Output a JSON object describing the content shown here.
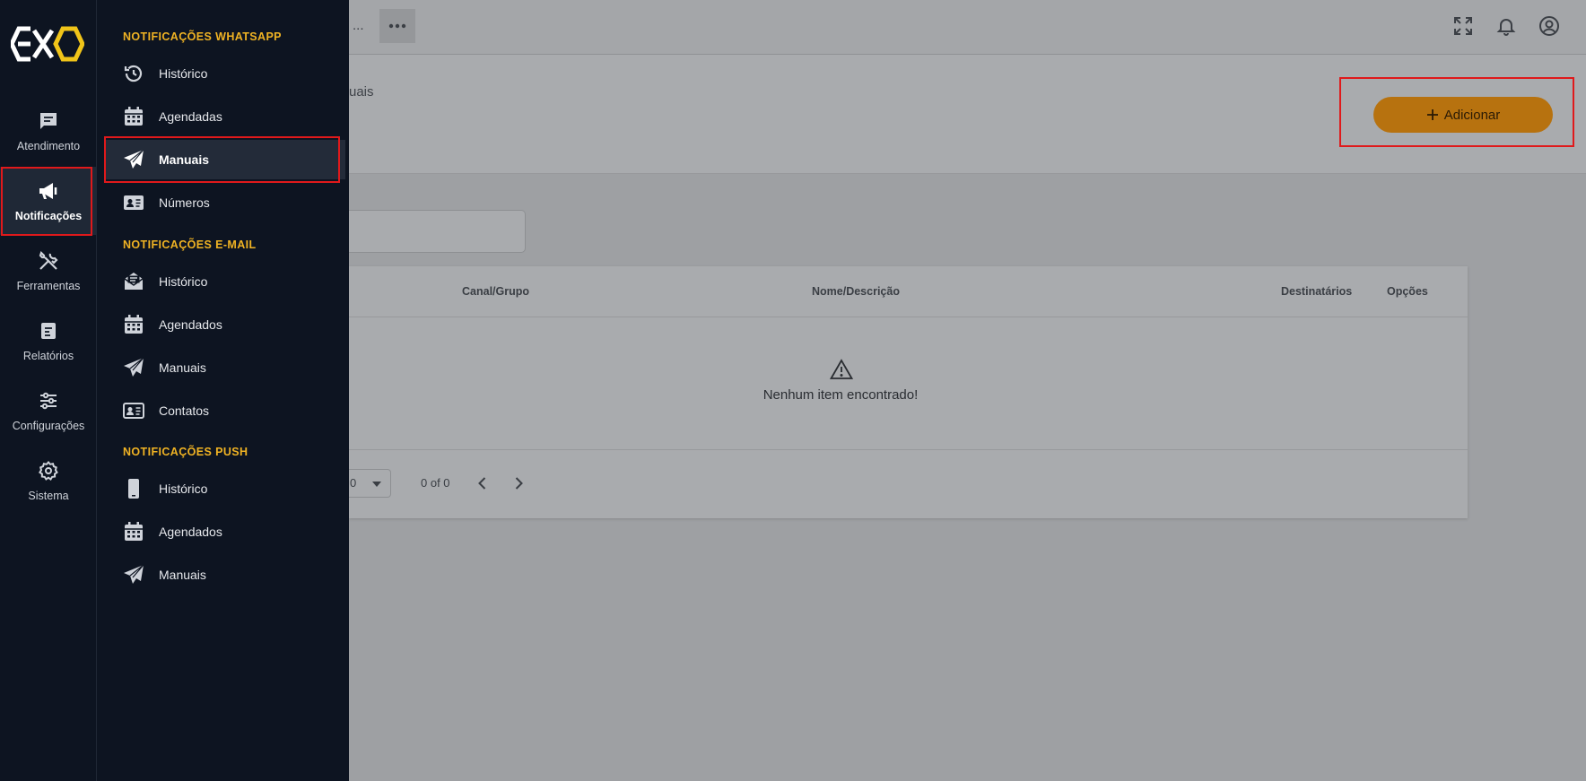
{
  "rail": {
    "items": [
      {
        "label": "Atendimento",
        "icon": "chat-icon"
      },
      {
        "label": "Notificações",
        "icon": "megaphone-icon"
      },
      {
        "label": "Ferramentas",
        "icon": "tools-icon"
      },
      {
        "label": "Relatórios",
        "icon": "report-icon"
      },
      {
        "label": "Configurações",
        "icon": "sliders-icon"
      },
      {
        "label": "Sistema",
        "icon": "gear-icon"
      }
    ],
    "active": "Notificações"
  },
  "submenu": {
    "whatsapp": {
      "title": "NOTIFICAÇÕES WHATSAPP",
      "items": [
        {
          "label": "Histórico",
          "icon": "history-icon"
        },
        {
          "label": "Agendadas",
          "icon": "calendar-icon"
        },
        {
          "label": "Manuais",
          "icon": "send-icon"
        },
        {
          "label": "Números",
          "icon": "contact-card-icon"
        }
      ]
    },
    "email": {
      "title": "NOTIFICAÇÕES E-MAIL",
      "items": [
        {
          "label": "Histórico",
          "icon": "mail-open-icon"
        },
        {
          "label": "Agendados",
          "icon": "calendar-icon"
        },
        {
          "label": "Manuais",
          "icon": "send-icon"
        },
        {
          "label": "Contatos",
          "icon": "contact-card-icon"
        }
      ]
    },
    "push": {
      "title": "NOTIFICAÇÕES PUSH",
      "items": [
        {
          "label": "Histórico",
          "icon": "phone-icon"
        },
        {
          "label": "Agendados",
          "icon": "calendar-icon"
        },
        {
          "label": "Manuais",
          "icon": "send-icon"
        }
      ]
    },
    "active": "whatsapp.Manuais"
  },
  "topbar": {
    "tab_fragment": "...",
    "icons": [
      "fullscreen-icon",
      "bell-icon",
      "user-circle-icon"
    ]
  },
  "header": {
    "breadcrumb_fragment": "uais",
    "add_button": "Adicionar"
  },
  "table": {
    "columns": [
      "Canal/Grupo",
      "Nome/Descrição",
      "Destinatários",
      "Opções"
    ],
    "empty_message": "Nenhum item encontrado!",
    "per_page_fragment": "0",
    "range": "0 of 0"
  },
  "colors": {
    "sidebar_bg": "#0d1421",
    "section_title": "#f0b323",
    "accent_button": "#b7720f",
    "highlight_border": "#e0191b"
  }
}
